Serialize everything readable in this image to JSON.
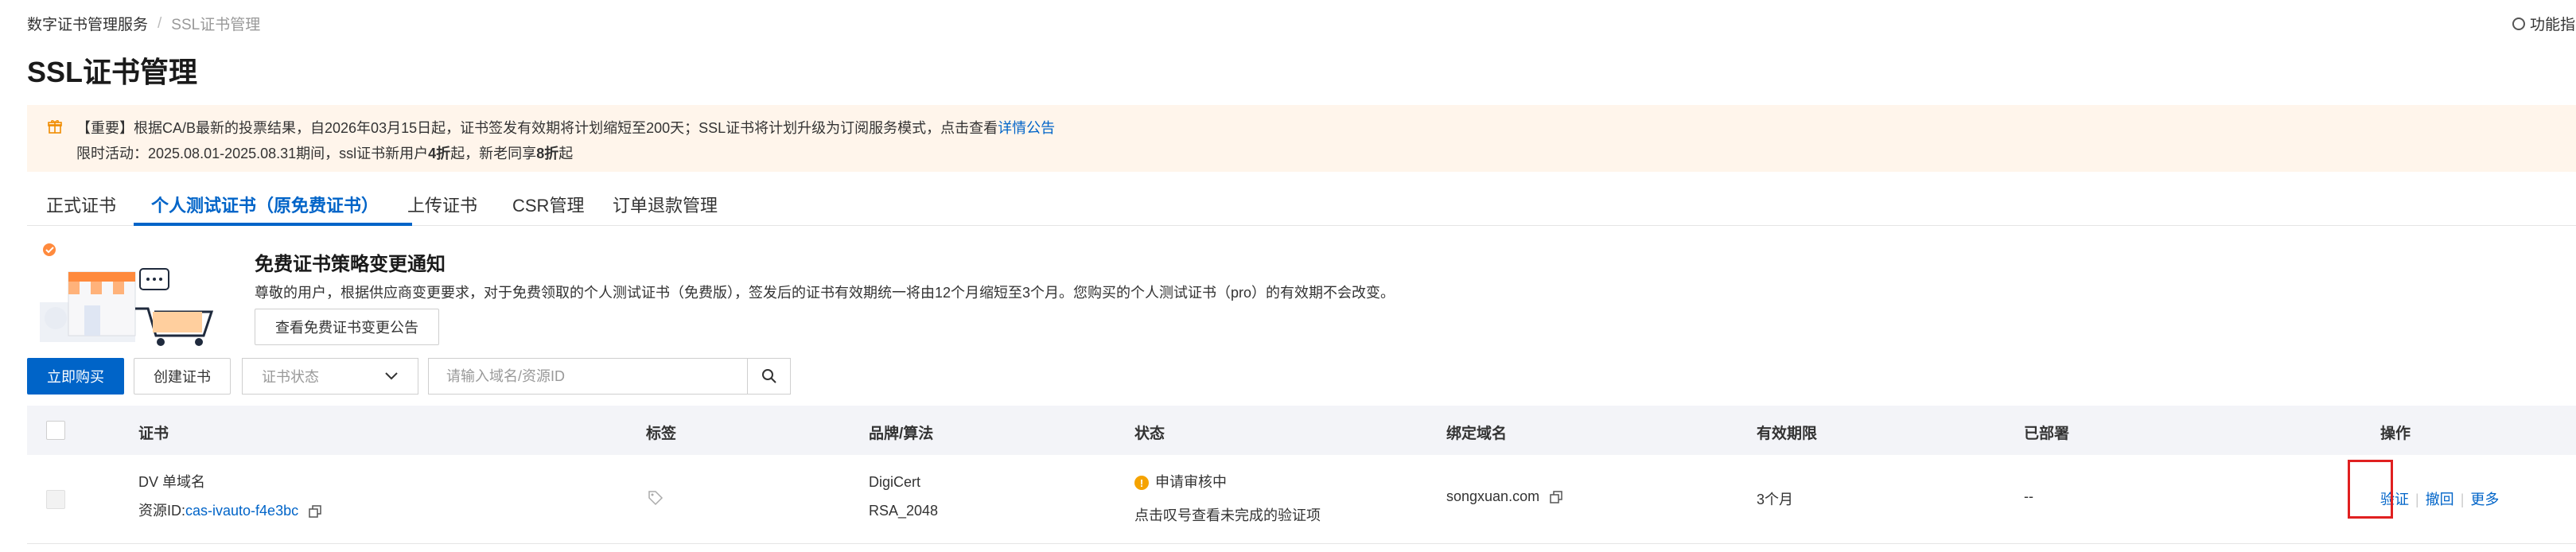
{
  "breadcrumb": {
    "root": "数字证书管理服务",
    "separator": "/",
    "current": "SSL证书管理"
  },
  "top_right": {
    "guide_label": "功能指"
  },
  "page": {
    "title": "SSL证书管理"
  },
  "notice": {
    "line1_text": "【重要】根据CA/B最新的投票结果，自2026年03月15日起，证书签发有效期将计划缩短至200天；SSL证书将计划升级为订阅服务模式，点击查看",
    "line1_link": "详情公告",
    "line2_text": "限时活动：2025.08.01-2025.08.31期间，ssl证书新用户",
    "line2_bold1": "4折",
    "line2_mid": "起，新老同享",
    "line2_bold2": "8折",
    "line2_end": "起"
  },
  "tabs": [
    {
      "label": "正式证书"
    },
    {
      "label": "个人测试证书（原免费证书）"
    },
    {
      "label": "上传证书"
    },
    {
      "label": "CSR管理"
    },
    {
      "label": "订单退款管理"
    }
  ],
  "promo": {
    "title": "免费证书策略变更通知",
    "description": "尊敬的用户，根据供应商变更要求，对于免费领取的个人测试证书（免费版），签发后的证书有效期统一将由12个月缩短至3个月。您购买的个人测试证书（pro）的有效期不会改变。",
    "button_label": "查看免费证书变更公告"
  },
  "toolbar": {
    "buy_label": "立即购买",
    "create_label": "创建证书",
    "status_select_value": "证书状态",
    "search_placeholder": "请输入域名/资源ID"
  },
  "table": {
    "columns": [
      "证书",
      "标签",
      "品牌/算法",
      "状态",
      "绑定域名",
      "有效期限",
      "已部署",
      "操作"
    ],
    "rows": [
      {
        "cert_name": "DV 单域名",
        "resource_label": "资源ID:",
        "resource_id": "cas-ivauto-f4e3bc",
        "brand": "DigiCert",
        "algorithm": "RSA_2048",
        "status": "申请审核中",
        "status_hint": "点击叹号查看未完成的验证项",
        "domain": "songxuan.com",
        "validity": "3个月",
        "deployed": "--",
        "actions": [
          "验证",
          "撤回",
          "更多"
        ]
      }
    ]
  },
  "colors": {
    "primary": "#0064c8",
    "notice_bg": "#fff5eb",
    "warning": "#f5a300",
    "highlight": "#e02020"
  }
}
